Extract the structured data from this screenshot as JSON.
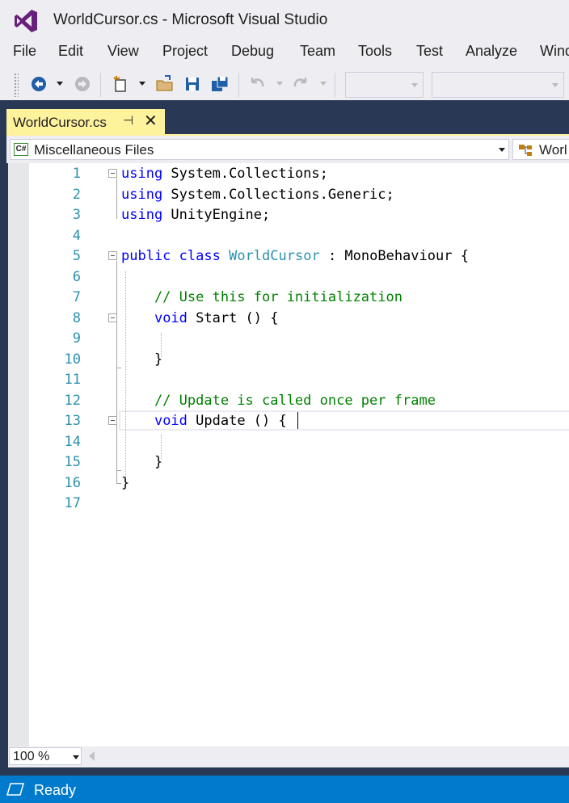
{
  "window": {
    "title": "WorldCursor.cs - Microsoft Visual Studio",
    "logo": "visual-studio-logo"
  },
  "menu": [
    "File",
    "Edit",
    "View",
    "Project",
    "Debug",
    "Team",
    "Tools",
    "Test",
    "Analyze",
    "Wind"
  ],
  "toolbar": {
    "buttons": [
      "back-icon",
      "forward-icon",
      "new-project-icon",
      "open-file-icon",
      "save-icon",
      "save-all-icon",
      "undo-icon",
      "redo-icon"
    ],
    "solution_config": "",
    "solution_platform": ""
  },
  "tab": {
    "title": "WorldCursor.cs",
    "pin_glyph": "⊣",
    "close_glyph": "✕"
  },
  "navbar": {
    "project_icon_text": "C#",
    "project": "Miscellaneous Files",
    "type_member": "Worl"
  },
  "editor": {
    "lines": [
      {
        "n": "1",
        "tokens": [
          {
            "t": "using",
            "c": "kw"
          },
          {
            "t": " System.Collections;",
            "c": ""
          }
        ]
      },
      {
        "n": "2",
        "tokens": [
          {
            "t": "using",
            "c": "kw"
          },
          {
            "t": " System.Collections.Generic;",
            "c": ""
          }
        ]
      },
      {
        "n": "3",
        "tokens": [
          {
            "t": "using",
            "c": "kw"
          },
          {
            "t": " UnityEngine;",
            "c": ""
          }
        ]
      },
      {
        "n": "4",
        "tokens": []
      },
      {
        "n": "5",
        "tokens": [
          {
            "t": "public",
            "c": "kw"
          },
          {
            "t": " ",
            "c": ""
          },
          {
            "t": "class",
            "c": "kw"
          },
          {
            "t": " ",
            "c": ""
          },
          {
            "t": "WorldCursor",
            "c": "ty"
          },
          {
            "t": " : MonoBehaviour {",
            "c": ""
          }
        ]
      },
      {
        "n": "6",
        "tokens": []
      },
      {
        "n": "7",
        "tokens": [
          {
            "t": "    // Use this for initialization",
            "c": "cm"
          }
        ]
      },
      {
        "n": "8",
        "tokens": [
          {
            "t": "    ",
            "c": ""
          },
          {
            "t": "void",
            "c": "kw"
          },
          {
            "t": " Start () {",
            "c": ""
          }
        ]
      },
      {
        "n": "9",
        "tokens": []
      },
      {
        "n": "10",
        "tokens": [
          {
            "t": "    }",
            "c": ""
          }
        ]
      },
      {
        "n": "11",
        "tokens": []
      },
      {
        "n": "12",
        "tokens": [
          {
            "t": "    // Update is called once per frame",
            "c": "cm"
          }
        ]
      },
      {
        "n": "13",
        "tokens": [
          {
            "t": "    ",
            "c": ""
          },
          {
            "t": "void",
            "c": "kw"
          },
          {
            "t": " Update () {",
            "c": ""
          }
        ]
      },
      {
        "n": "14",
        "tokens": []
      },
      {
        "n": "15",
        "tokens": [
          {
            "t": "    }",
            "c": ""
          }
        ]
      },
      {
        "n": "16",
        "tokens": [
          {
            "t": "}",
            "c": ""
          }
        ]
      },
      {
        "n": "17",
        "tokens": []
      }
    ],
    "current_line": 13,
    "colors": {
      "keyword": "#0000ff",
      "type": "#2b91af",
      "comment": "#008000",
      "line_number": "#2b91af"
    }
  },
  "zoom": "100 %",
  "status": "Ready",
  "colors": {
    "accent": "#007acc",
    "tab_active": "#fff29d",
    "document_well": "#293955"
  }
}
